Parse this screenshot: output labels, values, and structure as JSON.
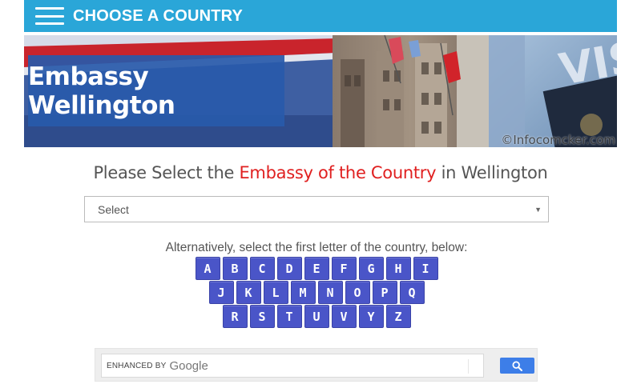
{
  "header": {
    "title": "CHOOSE A COUNTRY",
    "menu_icon": "hamburger-menu-icon"
  },
  "banner": {
    "title": "Embassy Wellington",
    "watermark": "©Infocomcker.com"
  },
  "heading": {
    "prefix": "Please Select the ",
    "highlight": "Embassy of the Country",
    "suffix": " in Wellington",
    "accent_color": "#e02020"
  },
  "select": {
    "value": "Select"
  },
  "alphabet": {
    "instruction": "Alternatively, select the first letter of the country, below:",
    "rows": [
      [
        "A",
        "B",
        "C",
        "D",
        "E",
        "F",
        "G",
        "H",
        "I"
      ],
      [
        "J",
        "K",
        "L",
        "M",
        "N",
        "O",
        "P",
        "Q"
      ],
      [
        "R",
        "S",
        "T",
        "U",
        "V",
        "Y",
        "Z"
      ]
    ],
    "button_color": "#4a55c8"
  },
  "search": {
    "enhanced_label": "ENHANCED BY",
    "brand": "Google",
    "button_icon": "search-icon",
    "button_color": "#3d7ee8"
  },
  "colors": {
    "header_bg": "#2aa6d8",
    "banner_box": "#285aaa"
  }
}
